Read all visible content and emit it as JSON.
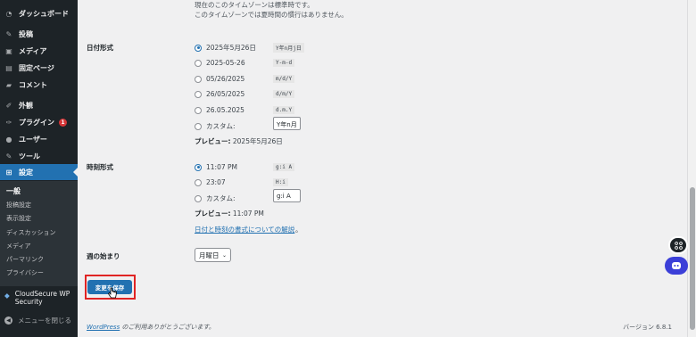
{
  "sidebar": {
    "items": [
      {
        "label": "ダッシュボード",
        "icon": "dashboard-icon",
        "glyph": "◔"
      },
      {
        "label": "投稿",
        "icon": "pushpin-icon",
        "glyph": "✎"
      },
      {
        "label": "メディア",
        "icon": "media-icon",
        "glyph": "▣"
      },
      {
        "label": "固定ページ",
        "icon": "page-icon",
        "glyph": "▤"
      },
      {
        "label": "コメント",
        "icon": "comment-icon",
        "glyph": "▰"
      },
      {
        "label": "外観",
        "icon": "brush-icon",
        "glyph": "✐"
      },
      {
        "label": "プラグイン",
        "icon": "plugin-icon",
        "glyph": "✑",
        "badge": "1"
      },
      {
        "label": "ユーザー",
        "icon": "user-icon",
        "glyph": "●"
      },
      {
        "label": "ツール",
        "icon": "wrench-icon",
        "glyph": "✎"
      },
      {
        "label": "設定",
        "icon": "settings-icon",
        "glyph": "⊞"
      }
    ],
    "submenu": [
      "一般",
      "投稿設定",
      "表示設定",
      "ディスカッション",
      "メディア",
      "パーマリンク",
      "プライバシー"
    ],
    "cloudsecure": {
      "line1": "CloudSecure WP",
      "line2": "Security"
    },
    "collapse_label": "メニューを閉じる"
  },
  "timezone": {
    "line1": "現在のこのタイムゾーンは標準時です。",
    "line2": "このタイムゾーンでは夏時間の慣行はありません。"
  },
  "date_format": {
    "label": "日付形式",
    "options": [
      {
        "text": "2025年5月26日",
        "code": "Y年n月j日",
        "checked": true
      },
      {
        "text": "2025-05-26",
        "code": "Y-m-d",
        "checked": false
      },
      {
        "text": "05/26/2025",
        "code": "m/d/Y",
        "checked": false
      },
      {
        "text": "26/05/2025",
        "code": "d/m/Y",
        "checked": false
      },
      {
        "text": "26.05.2025",
        "code": "d.m.Y",
        "checked": false
      }
    ],
    "custom_label": "カスタム:",
    "custom_value": "Y年n月",
    "preview_label": "プレビュー:",
    "preview_value": "2025年5月26日"
  },
  "time_format": {
    "label": "時刻形式",
    "options": [
      {
        "text": "11:07 PM",
        "code": "g:i A",
        "checked": true
      },
      {
        "text": "23:07",
        "code": "H:i",
        "checked": false
      }
    ],
    "custom_label": "カスタム:",
    "custom_value": "g:i A",
    "preview_label": "プレビュー:",
    "preview_value": "11:07 PM"
  },
  "doc_link": "日付と時刻の書式についての解説",
  "doc_link_suffix": "。",
  "week_start": {
    "label": "週の始まり",
    "selected": "月曜日"
  },
  "save_button": "変更を保存",
  "footer": {
    "wp_link": "WordPress",
    "thanks": " のご利用ありがとうございます。",
    "version": "バージョン 6.8.1"
  },
  "colors": {
    "accent": "#2271b1",
    "sidebar": "#1d2327",
    "highlight": "#e02424",
    "badge": "#d63638"
  }
}
